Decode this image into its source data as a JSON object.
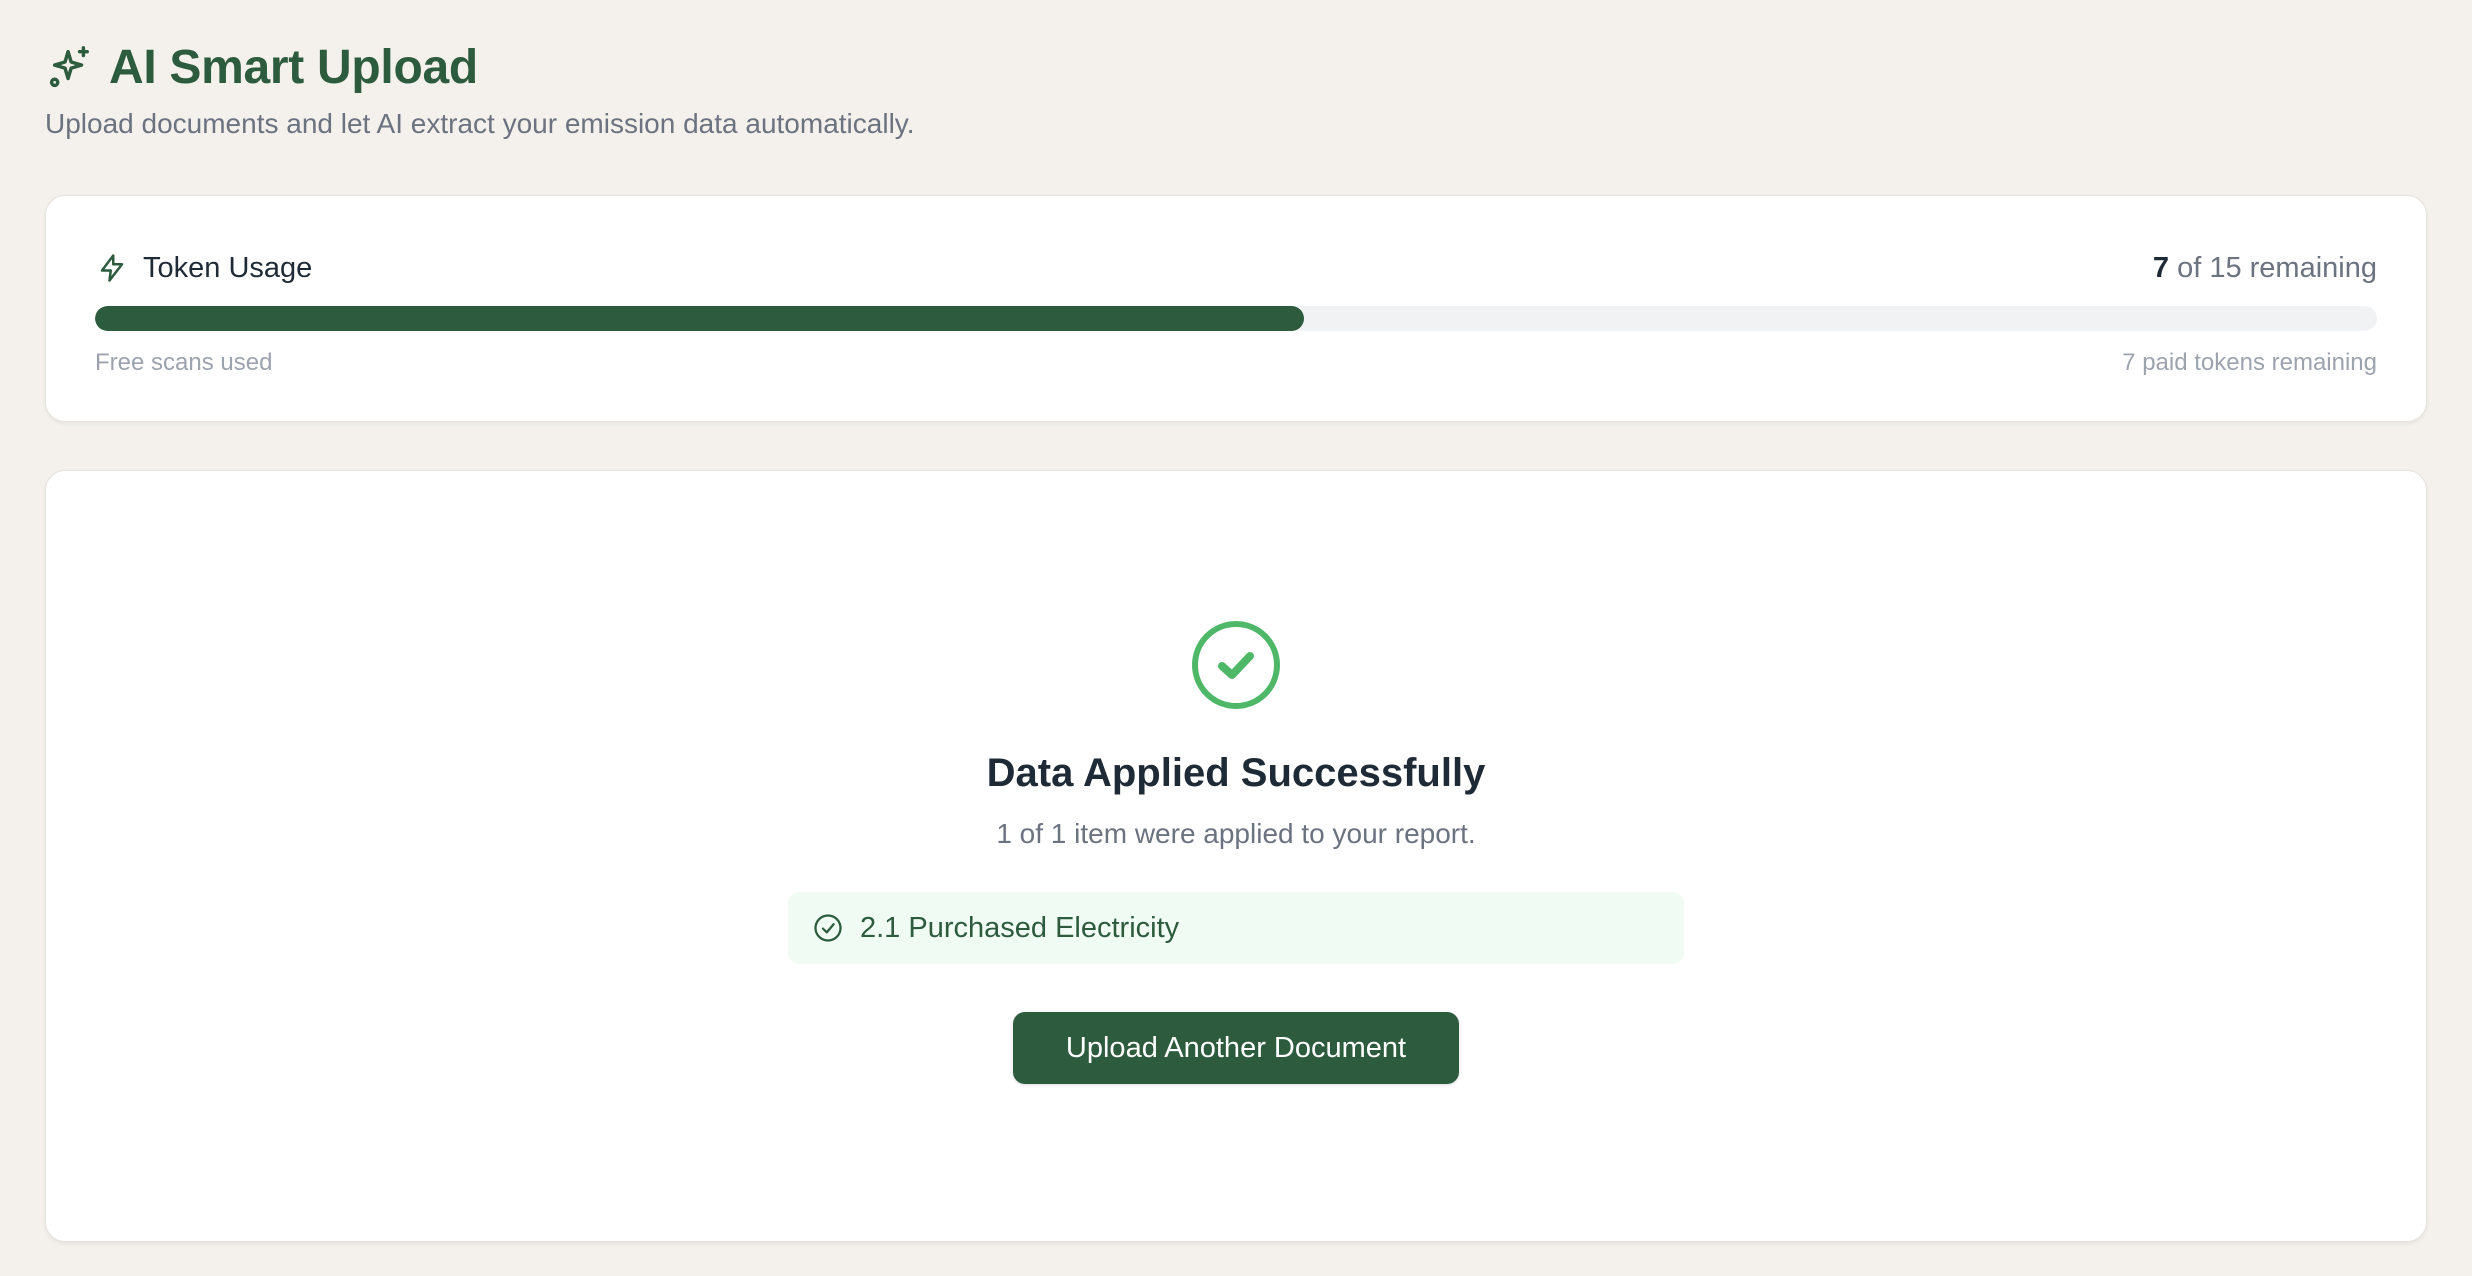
{
  "header": {
    "title": "AI Smart Upload",
    "subtitle": "Upload documents and let AI extract your emission data automatically.",
    "icon": "sparkles-icon"
  },
  "token_usage": {
    "label": "Token Usage",
    "icon": "lightning-bolt-icon",
    "used": "7",
    "remaining_text": " of 15 remaining",
    "progress_fraction": 0.53,
    "left_caption": "Free scans used",
    "right_caption": "7 paid tokens remaining"
  },
  "result": {
    "icon": "check-circle-icon",
    "title": "Data Applied Successfully",
    "subtitle": "1 of 1 item were applied to your report.",
    "applied_items": [
      {
        "label": "2.1 Purchased Electricity",
        "icon": "check-circle-small-icon"
      }
    ],
    "button_label": "Upload Another Document"
  },
  "colors": {
    "brand_green": "#2d5b3d",
    "success_green": "#4fb868",
    "background": "#f4f1ec",
    "applied_bg": "#f0fbf3"
  }
}
